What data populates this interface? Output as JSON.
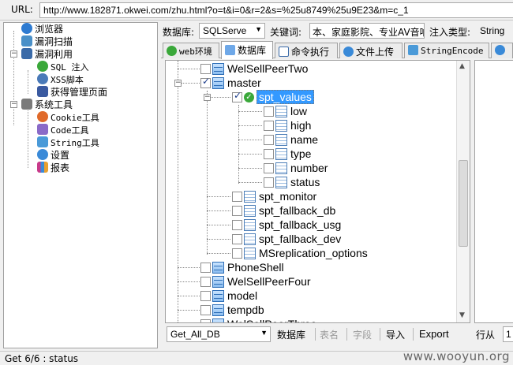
{
  "url_bar": {
    "label": "URL:",
    "value": "http://www.182871.okwei.com/zhu.html?o=t&i=0&r=2&s=%25u8749%25u9E23&m=c_1"
  },
  "left_tree": {
    "items": [
      {
        "label": "浏览器",
        "icon": "browser-icon",
        "color": "#2e7bd1"
      },
      {
        "label": "漏洞扫描",
        "icon": "scan-icon",
        "color": "#4a90c8"
      },
      {
        "label": "漏洞利用",
        "icon": "exploit-icon",
        "color": "#3a6aa8"
      },
      {
        "label": "SQL 注入",
        "icon": "sql-check-icon",
        "color": "#3aa83a"
      },
      {
        "label": "XSS脚本",
        "icon": "xss-icon",
        "color": "#4a7ab8"
      },
      {
        "label": "获得管理页面",
        "icon": "admin-user-icon",
        "color": "#3a5aa0"
      },
      {
        "label": "系统工具",
        "icon": "tools-icon",
        "color": "#6a6a6a"
      },
      {
        "label": "Cookie工具",
        "icon": "cookie-icon",
        "color": "#e06a2a"
      },
      {
        "label": "Code工具",
        "icon": "code-icon",
        "color": "#8a6ac8"
      },
      {
        "label": "String工具",
        "icon": "string-icon",
        "color": "#4a9ad8"
      },
      {
        "label": "设置",
        "icon": "gear-icon",
        "color": "#3a8ad8"
      },
      {
        "label": "报表",
        "icon": "report-chart-icon",
        "color": "#c83a8a"
      }
    ]
  },
  "top_row": {
    "db_label": "数据库:",
    "db_value": "SQLServe",
    "keyword_label": "关键词:",
    "keyword_value": "本、家庭影院、专业AV音响",
    "inject_label": "注入类型:",
    "inject_value": "String"
  },
  "tabs": [
    {
      "label": "web环境",
      "icon": "web-env-icon",
      "active": false
    },
    {
      "label": "数据库",
      "icon": "database-icon",
      "active": true
    },
    {
      "label": "命令执行",
      "icon": "command-icon",
      "active": false
    },
    {
      "label": "文件上传",
      "icon": "upload-icon",
      "active": false
    },
    {
      "label": "StringEncode",
      "icon": "encode-icon",
      "active": false
    },
    {
      "label": "",
      "icon": "settings-tab-icon",
      "active": false
    }
  ],
  "db_tree": {
    "nodes": [
      {
        "label": "WelSellPeerTwo"
      },
      {
        "label": "master"
      },
      {
        "label": "spt_values"
      },
      {
        "label": "low"
      },
      {
        "label": "high"
      },
      {
        "label": "name"
      },
      {
        "label": "type"
      },
      {
        "label": "number"
      },
      {
        "label": "status"
      },
      {
        "label": "spt_monitor"
      },
      {
        "label": "spt_fallback_db"
      },
      {
        "label": "spt_fallback_usg"
      },
      {
        "label": "spt_fallback_dev"
      },
      {
        "label": "MSreplication_options"
      },
      {
        "label": "PhoneShell"
      },
      {
        "label": "WelSellPeerFour"
      },
      {
        "label": "model"
      },
      {
        "label": "tempdb"
      },
      {
        "label": "WelSellPeerThree"
      }
    ]
  },
  "bottom_toolbar": {
    "stored_proc_value": "Get_All_DB",
    "btn_database": "数据库",
    "btn_table": "表名",
    "btn_field": "字段",
    "btn_import": "导入",
    "btn_export": "Export",
    "row_label": "行从",
    "row_value": "1"
  },
  "status_bar": {
    "text": "Get 6/6 :  status",
    "watermark": "www.wooyun.org"
  }
}
